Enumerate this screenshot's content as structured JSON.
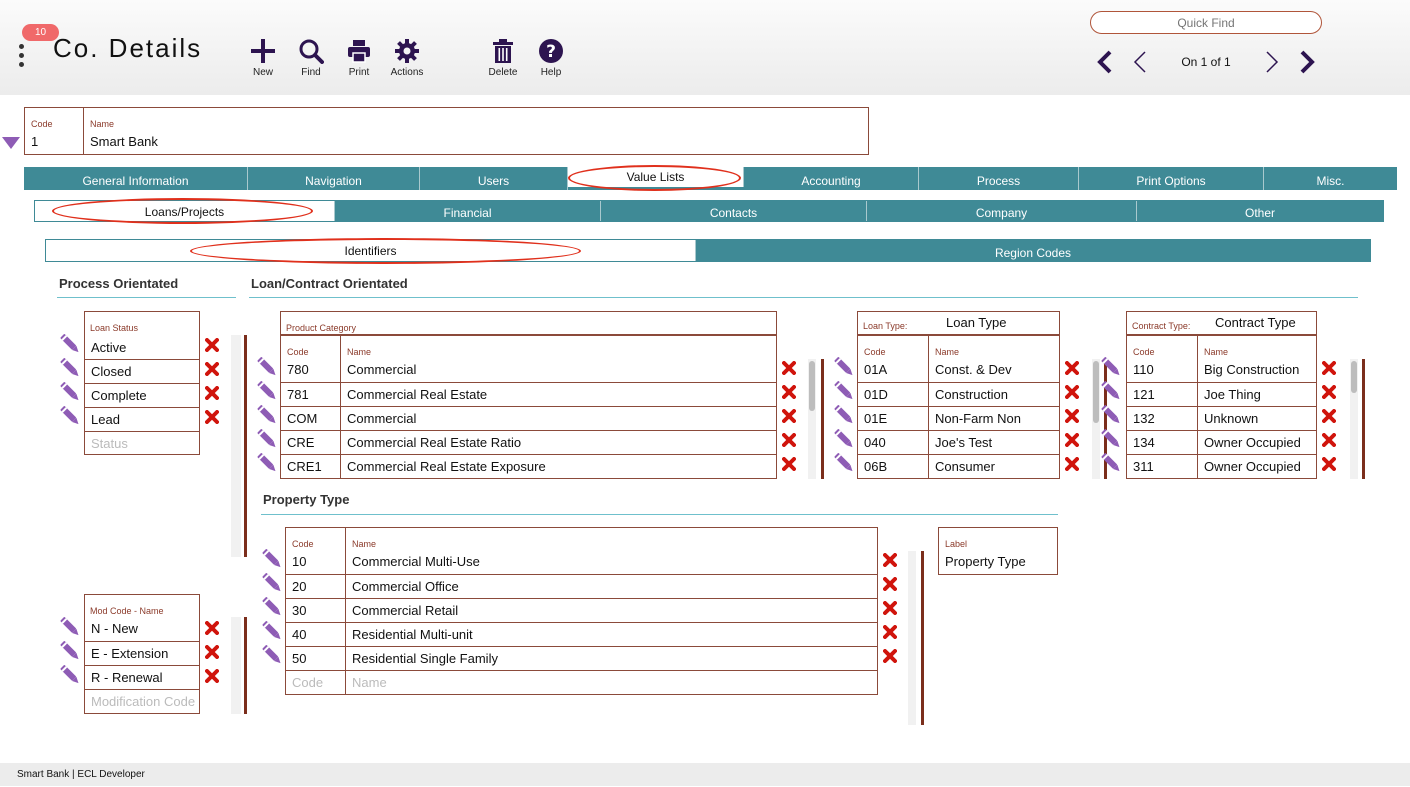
{
  "header": {
    "badge": "10",
    "title": "Co. Details",
    "tools": [
      {
        "label": "New",
        "icon": "plus-icon"
      },
      {
        "label": "Find",
        "icon": "search-icon"
      },
      {
        "label": "Print",
        "icon": "printer-icon"
      },
      {
        "label": "Actions",
        "icon": "gear-icon"
      },
      {
        "label": "Delete",
        "icon": "trash-icon"
      },
      {
        "label": "Help",
        "icon": "help-icon"
      }
    ],
    "quick_find_placeholder": "Quick Find",
    "record_position": "On 1 of 1"
  },
  "record": {
    "code_label": "Code",
    "code_value": "1",
    "name_label": "Name",
    "name_value": "Smart Bank"
  },
  "main_tabs": [
    "General Information",
    "Navigation",
    "Users",
    "Value Lists",
    "Accounting",
    "Process",
    "Print Options",
    "Misc."
  ],
  "main_tab_active": "Value Lists",
  "sub_tabs": [
    "Loans/Projects",
    "Financial",
    "Contacts",
    "Company",
    "Other"
  ],
  "sub_tab_active": "Loans/Projects",
  "inner_tabs": [
    "Identifiers",
    "Region Codes"
  ],
  "inner_tab_active": "Identifiers",
  "sections": {
    "process": "Process Orientated",
    "loan_contract": "Loan/Contract Orientated",
    "property_type": "Property Type"
  },
  "loan_status": {
    "label": "Loan Status",
    "items": [
      "Active",
      "Closed",
      "Complete",
      "Lead"
    ],
    "placeholder": "Status"
  },
  "mod_code": {
    "label": "Mod Code - Name",
    "items": [
      "N - New",
      "E - Extension",
      "R - Renewal"
    ],
    "placeholder": "Modification Code"
  },
  "product_category": {
    "title": "Product Category",
    "code_header": "Code",
    "name_header": "Name",
    "rows": [
      {
        "code": "780",
        "name": "Commercial"
      },
      {
        "code": "781",
        "name": "Commercial Real Estate"
      },
      {
        "code": "COM",
        "name": "Commercial"
      },
      {
        "code": "CRE",
        "name": "Commercial Real Estate Ratio"
      },
      {
        "code": "CRE1",
        "name": "Commercial Real Estate Exposure"
      }
    ]
  },
  "loan_type": {
    "label": "Loan Type:",
    "value": "Loan Type",
    "code_header": "Code",
    "name_header": "Name",
    "rows": [
      {
        "code": "01A",
        "name": "Const. & Dev"
      },
      {
        "code": "01D",
        "name": "Construction"
      },
      {
        "code": "01E",
        "name": "Non-Farm Non"
      },
      {
        "code": "040",
        "name": "Joe's Test"
      },
      {
        "code": "06B",
        "name": "Consumer"
      }
    ]
  },
  "contract_type": {
    "label": "Contract Type:",
    "value": "Contract Type",
    "code_header": "Code",
    "name_header": "Name",
    "rows": [
      {
        "code": "110",
        "name": "Big Construction"
      },
      {
        "code": "121",
        "name": "Joe Thing"
      },
      {
        "code": "132",
        "name": "Unknown"
      },
      {
        "code": "134",
        "name": "Owner Occupied"
      },
      {
        "code": "311",
        "name": "Owner Occupied"
      }
    ]
  },
  "property_type": {
    "code_header": "Code",
    "name_header": "Name",
    "rows": [
      {
        "code": "10",
        "name": "Commercial Multi-Use"
      },
      {
        "code": "20",
        "name": "Commercial Office"
      },
      {
        "code": "30",
        "name": "Commercial Retail"
      },
      {
        "code": "40",
        "name": "Residential Multi-unit"
      },
      {
        "code": "50",
        "name": "Residential Single Family"
      }
    ],
    "code_placeholder": "Code",
    "name_placeholder": "Name",
    "label_caption": "Label",
    "label_value": "Property Type"
  },
  "footer": "Smart Bank | ECL Developer",
  "colors": {
    "teal": "#3f8a96",
    "brown": "#8b4a3a",
    "purple": "#8e5cb5",
    "red": "#d0140c",
    "nav": "#2d1450"
  }
}
